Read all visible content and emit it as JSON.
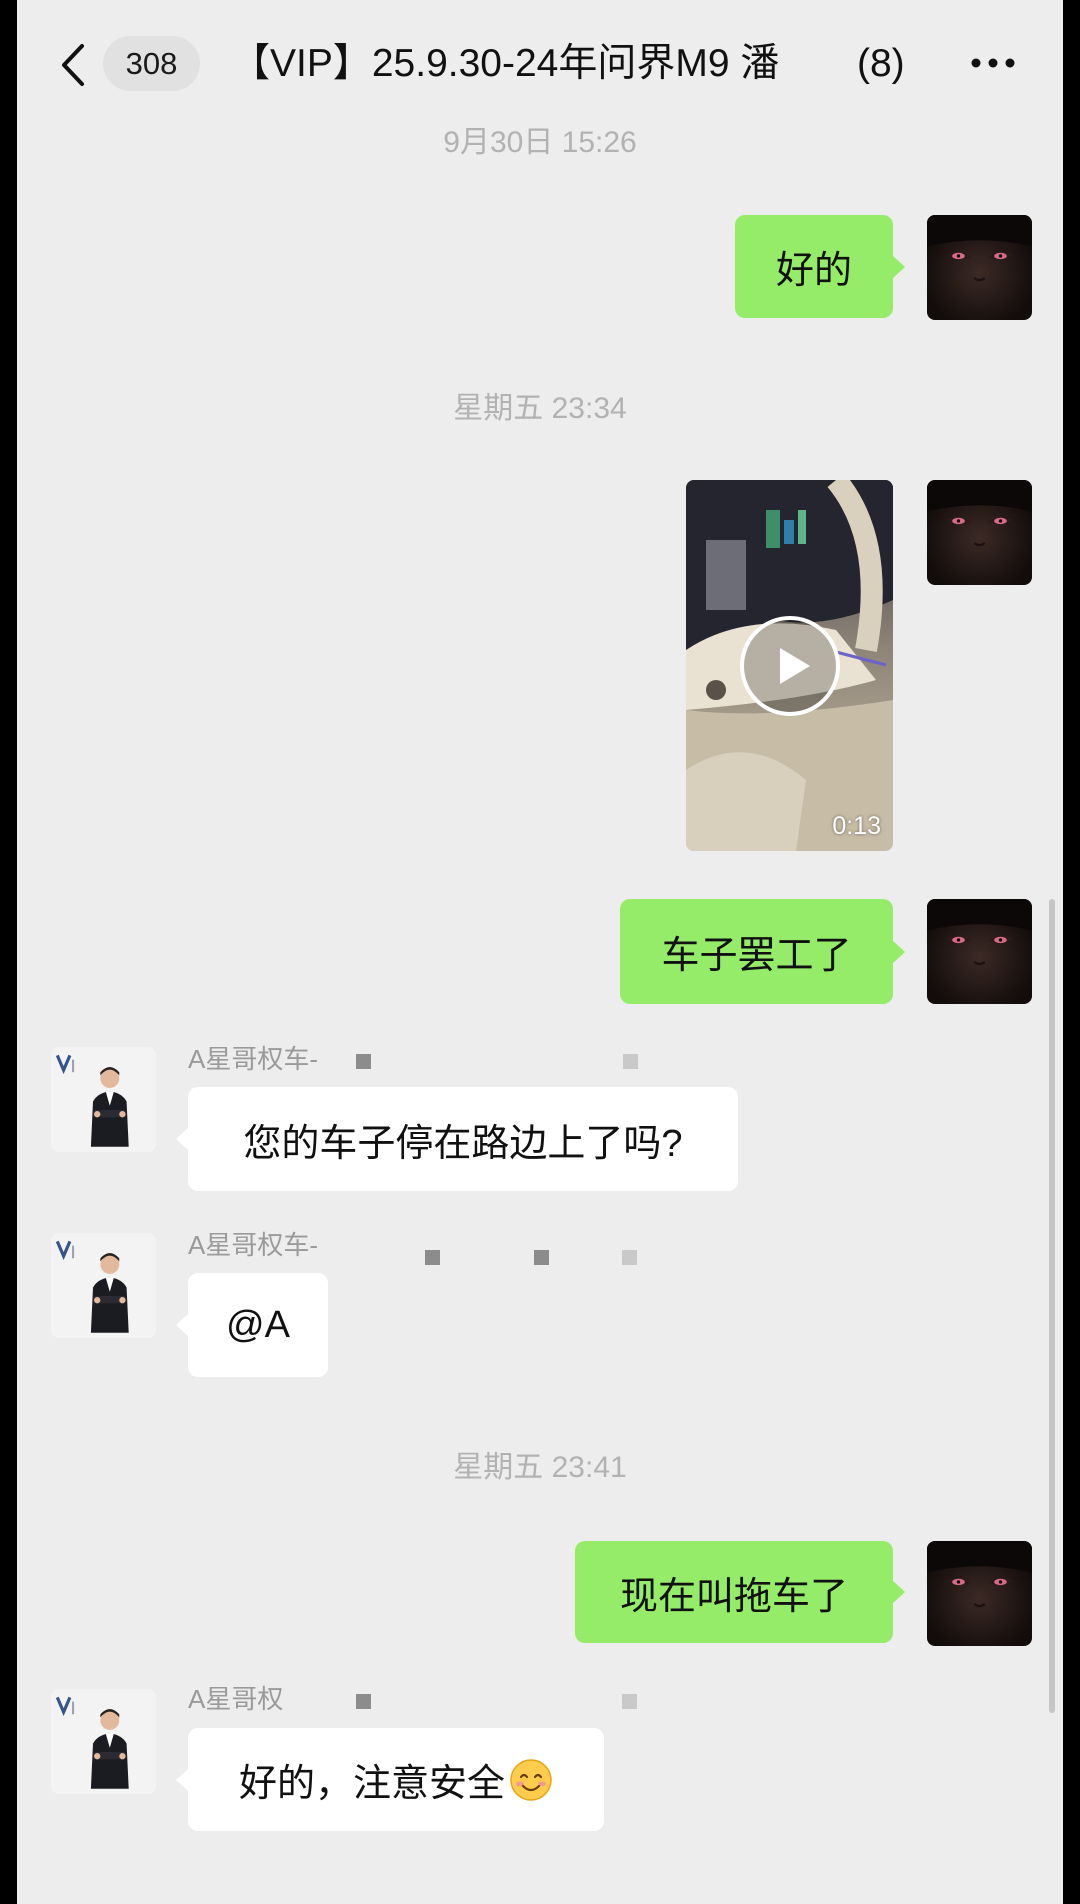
{
  "theme": {
    "background": "#ededed",
    "bubble_outgoing": "#95ec69",
    "bubble_incoming": "#ffffff",
    "timestamp_color": "#b2b2b2"
  },
  "header": {
    "back_icon": "chevron-left-icon",
    "unread_count": "308",
    "title": "【VIP】25.9.30-24年问界M9 潘",
    "member_count": "(8)",
    "more_icon": "more-dots-icon"
  },
  "timestamps": [
    "9月30日 15:26",
    "星期五 23:34",
    "星期五 23:41"
  ],
  "messages": [
    {
      "side": "right",
      "type": "text",
      "text": "好的"
    },
    {
      "side": "right",
      "type": "video",
      "duration": "0:13",
      "play_icon": "play-icon"
    },
    {
      "side": "right",
      "type": "text",
      "text": "车子罢工了"
    },
    {
      "side": "left",
      "type": "text",
      "sender": "A星哥权车-",
      "text": "您的车子停在路边上了吗?"
    },
    {
      "side": "left",
      "type": "text",
      "sender": "A星哥权车-",
      "text": "@A"
    },
    {
      "side": "right",
      "type": "text",
      "text": "现在叫拖车了"
    },
    {
      "side": "left",
      "type": "text",
      "sender": "A星哥权",
      "text": "好的，注意安全",
      "emoji": "smiling-face-icon"
    }
  ]
}
